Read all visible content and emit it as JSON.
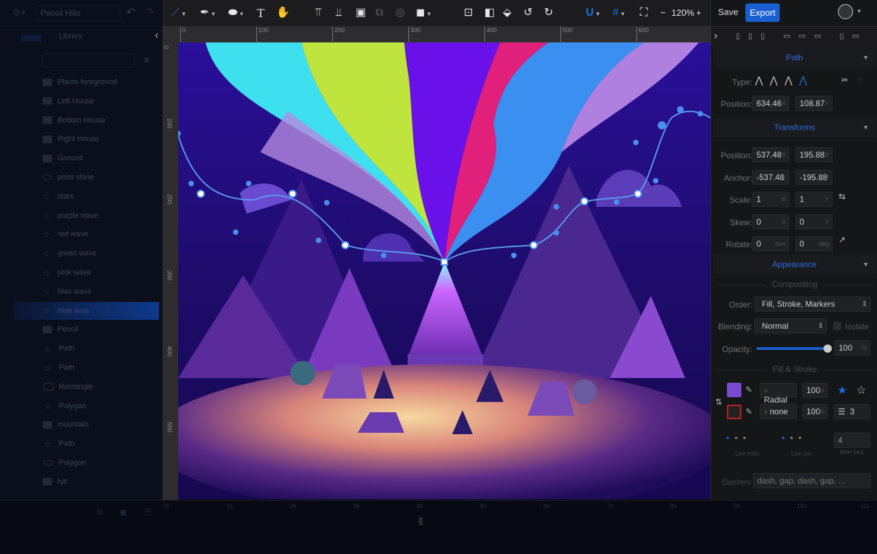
{
  "project": {
    "name": "Pencil Hills"
  },
  "left_panel": {
    "tabs": [
      {
        "label": ""
      },
      {
        "label": "Library"
      }
    ],
    "layers": [
      {
        "label": "Plants foreground",
        "icon": "folder-icon"
      },
      {
        "label": "Left House",
        "icon": "folder-icon"
      },
      {
        "label": "Bottom House",
        "icon": "folder-icon"
      },
      {
        "label": "Right House",
        "icon": "folder-icon"
      },
      {
        "label": "Ground",
        "icon": "folder-icon"
      },
      {
        "label": "point shine",
        "icon": "ellipse-icon"
      },
      {
        "label": "stars",
        "icon": "path-icon"
      },
      {
        "label": "purple wave",
        "icon": "path-icon"
      },
      {
        "label": "red wave",
        "icon": "path-icon"
      },
      {
        "label": "green wave",
        "icon": "path-icon"
      },
      {
        "label": "pink wave",
        "icon": "path-icon"
      },
      {
        "label": "blue wave",
        "icon": "path-icon"
      },
      {
        "label": "blue aura",
        "icon": "path-icon",
        "selected": true
      },
      {
        "label": "Pencil",
        "icon": "folder-open-icon"
      },
      {
        "label": "Path",
        "icon": "path-icon",
        "child": true
      },
      {
        "label": "Path",
        "icon": "path-icon",
        "child": true
      },
      {
        "label": "Rectangle",
        "icon": "rectangle-icon",
        "child": true
      },
      {
        "label": "Polygon",
        "icon": "path-icon",
        "child": true
      },
      {
        "label": "mountain",
        "icon": "folder-open-icon"
      },
      {
        "label": "Path",
        "icon": "path-icon",
        "child": true
      },
      {
        "label": "Polygon",
        "icon": "polygon-icon",
        "child": true
      },
      {
        "label": "hill",
        "icon": "folder-icon"
      }
    ]
  },
  "toolbar": {
    "zoom": "120%",
    "save": "Save",
    "export": "Export",
    "text_tool": "T",
    "accent": "#1a5fd0"
  },
  "rulers": {
    "top": [
      "0",
      "100",
      "200",
      "300",
      "400",
      "500",
      "600"
    ],
    "left": [
      "0",
      "100",
      "200",
      "300",
      "400",
      "500"
    ]
  },
  "inspector": {
    "path": {
      "title": "Path",
      "type_label": "Type:",
      "position_label": "Position:",
      "x": "634.46",
      "y": "108.87"
    },
    "transforms": {
      "title": "Transforms",
      "rows": [
        {
          "label": "Position:",
          "a": "537.48",
          "au": "X",
          "b": "195.88",
          "bu": "Y"
        },
        {
          "label": "Anchor:",
          "a": "-537.48",
          "au": "X",
          "b": "-195.88",
          "bu": "Y"
        },
        {
          "label": "Scale:",
          "a": "1",
          "au": "X",
          "b": "1",
          "bu": "Y"
        },
        {
          "label": "Skew:",
          "a": "0",
          "au": "X",
          "b": "0",
          "bu": "Y"
        },
        {
          "label": "Rotate:",
          "a": "0",
          "au": "turn",
          "b": "0",
          "bu": "deg"
        }
      ]
    },
    "appearance": {
      "title": "Appearance",
      "compositing": "Compositing",
      "order_label": "Order:",
      "order": "Fill, Stroke, Markers",
      "blending_label": "Blending:",
      "blending": "Normal",
      "isolate": "Isolate",
      "opacity_label": "Opacity:",
      "opacity": "100",
      "opacity_unit": "%",
      "opacity_value": 100,
      "fill_stroke": "Fill & Stroke",
      "fill": {
        "value": "Radial",
        "alpha": "100"
      },
      "stroke": {
        "value": "none",
        "alpha": "100",
        "width": "3"
      },
      "hash": "#",
      "pct": "%",
      "line_ends": "Line ends",
      "line_join": "Line join",
      "miter": "4",
      "miter_label": "Miter limit",
      "dashes_label": "Dashes:",
      "dashes_placeholder": "dash, gap, dash, gap, ..."
    }
  },
  "timeline": {
    "ticks": [
      "0s",
      "1s",
      "2s",
      "3s",
      "4s",
      "5s",
      "6s",
      "7s",
      "8s",
      "9s",
      "10s",
      "11s"
    ]
  }
}
